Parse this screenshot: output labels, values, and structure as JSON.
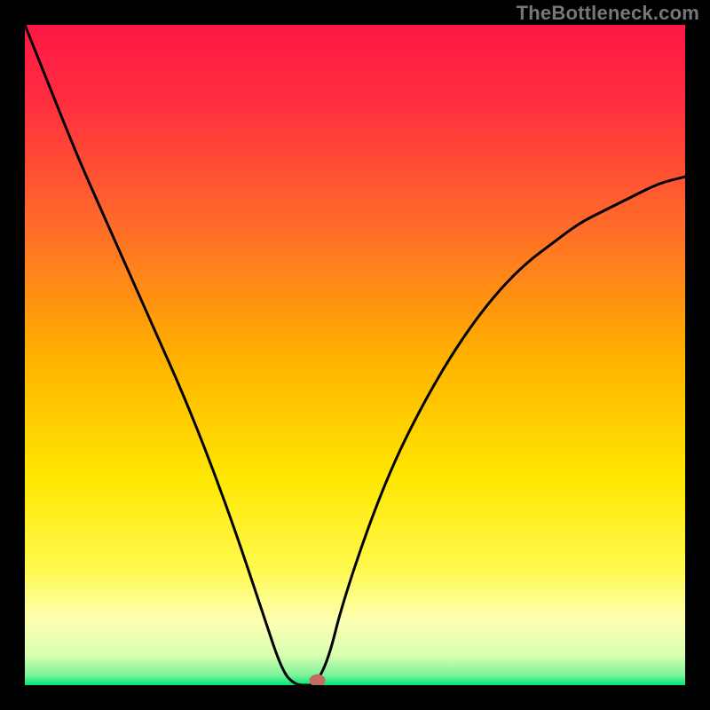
{
  "watermark": "TheBottleneck.com",
  "chart_data": {
    "type": "line",
    "title": "",
    "xlabel": "",
    "ylabel": "",
    "xlim": [
      0,
      100
    ],
    "ylim": [
      0,
      100
    ],
    "grid": false,
    "legend": false,
    "background_gradient_stops": [
      {
        "offset": 0.0,
        "color": "#ff1744"
      },
      {
        "offset": 0.12,
        "color": "#ff2f3f"
      },
      {
        "offset": 0.3,
        "color": "#ff6a2a"
      },
      {
        "offset": 0.5,
        "color": "#ffb000"
      },
      {
        "offset": 0.68,
        "color": "#ffe600"
      },
      {
        "offset": 0.82,
        "color": "#fff94a"
      },
      {
        "offset": 0.9,
        "color": "#feffb0"
      },
      {
        "offset": 0.955,
        "color": "#d8ffb0"
      },
      {
        "offset": 0.985,
        "color": "#7cf29a"
      },
      {
        "offset": 1.0,
        "color": "#00e57a"
      }
    ],
    "series": [
      {
        "name": "bottleneck-curve",
        "x": [
          0,
          4,
          8,
          12,
          16,
          20,
          24,
          28,
          32,
          36,
          39,
          41,
          43,
          44,
          46,
          48,
          52,
          56,
          60,
          64,
          68,
          72,
          76,
          80,
          84,
          88,
          92,
          96,
          100
        ],
        "y": [
          100,
          90,
          80,
          71,
          62,
          53,
          44,
          34,
          23,
          11,
          2,
          0,
          0,
          0,
          4,
          12,
          24,
          34,
          42,
          49,
          55,
          60,
          64,
          67,
          70,
          72,
          74,
          76,
          77
        ]
      }
    ],
    "marker": {
      "x": 44.3,
      "y": 0.7,
      "color": "#c46a5f",
      "rx": 9,
      "ry": 7
    }
  }
}
